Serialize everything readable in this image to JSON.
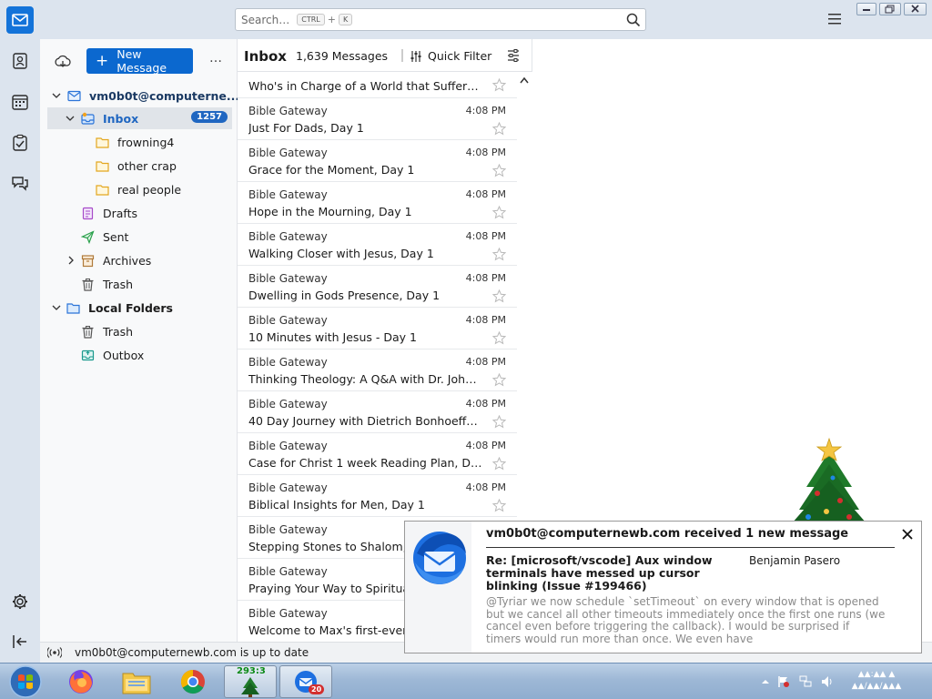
{
  "search": {
    "placeholder": "Search…",
    "shortcut_ctrl": "CTRL",
    "shortcut_plus": "+",
    "shortcut_key": "K"
  },
  "folder_pane": {
    "new_message_label": "New Message",
    "more_label": "…",
    "account": "vm0b0t@computerne...",
    "inbox_label": "Inbox",
    "inbox_unread": "1257",
    "subfolders": [
      "frowning4",
      "other crap",
      "real people"
    ],
    "drafts": "Drafts",
    "sent": "Sent",
    "archives": "Archives",
    "trash": "Trash",
    "local_folders": "Local Folders",
    "local_trash": "Trash",
    "outbox": "Outbox"
  },
  "message_list": {
    "title": "Inbox",
    "count": "1,639 Messages",
    "quick_filter": "Quick Filter",
    "first_subject": "Who's in Charge of a World that Suffers? D...",
    "rows": [
      {
        "from": "Bible Gateway",
        "time": "4:08 PM",
        "subject": "Just For Dads, Day 1"
      },
      {
        "from": "Bible Gateway",
        "time": "4:08 PM",
        "subject": "Grace for the Moment, Day 1"
      },
      {
        "from": "Bible Gateway",
        "time": "4:08 PM",
        "subject": "Hope in the Mourning, Day 1"
      },
      {
        "from": "Bible Gateway",
        "time": "4:08 PM",
        "subject": "Walking Closer with Jesus, Day 1"
      },
      {
        "from": "Bible Gateway",
        "time": "4:08 PM",
        "subject": "Dwelling in Gods Presence, Day 1"
      },
      {
        "from": "Bible Gateway",
        "time": "4:08 PM",
        "subject": "10 Minutes with Jesus - Day 1"
      },
      {
        "from": "Bible Gateway",
        "time": "4:08 PM",
        "subject": "Thinking Theology: A Q&A with Dr. John M..."
      },
      {
        "from": "Bible Gateway",
        "time": "4:08 PM",
        "subject": "40 Day Journey with Dietrich Bonhoeffer, D..."
      },
      {
        "from": "Bible Gateway",
        "time": "4:08 PM",
        "subject": "Case for Christ 1 week Reading Plan, Day 1"
      },
      {
        "from": "Bible Gateway",
        "time": "4:08 PM",
        "subject": "Biblical Insights for Men, Day 1"
      },
      {
        "from": "Bible Gateway",
        "time": "",
        "subject": "Stepping Stones to Shalom, D"
      },
      {
        "from": "Bible Gateway",
        "time": "",
        "subject": "Praying Your Way to Spiritual"
      },
      {
        "from": "Bible Gateway",
        "time": "",
        "subject": "Welcome to Max's first-ever r"
      }
    ]
  },
  "status": {
    "text": "vm0b0t@computernewb.com is up to date"
  },
  "notification": {
    "heading": "vm0b0t@computernewb.com received 1 new message",
    "subject": "Re: [microsoft/vscode] Aux window terminals have messed up cursor blinking (Issue #199466)",
    "sender": "Benjamin Pasero",
    "body": "@Tyriar we now schedule `setTimeout` on every window that is opened but we cancel all other timeouts immediately once the first one runs (we cancel even before triggering the callback). I would be surprised if timers would run more than once. We even have"
  },
  "taskbar": {
    "gadget_text": "293:3",
    "thunderbird_badge": "20"
  },
  "colors": {
    "accent": "#0b68cf",
    "spaces_bg": "#dce4ee",
    "folder_icon": "#f5c242",
    "badge": "#1f66c1"
  }
}
